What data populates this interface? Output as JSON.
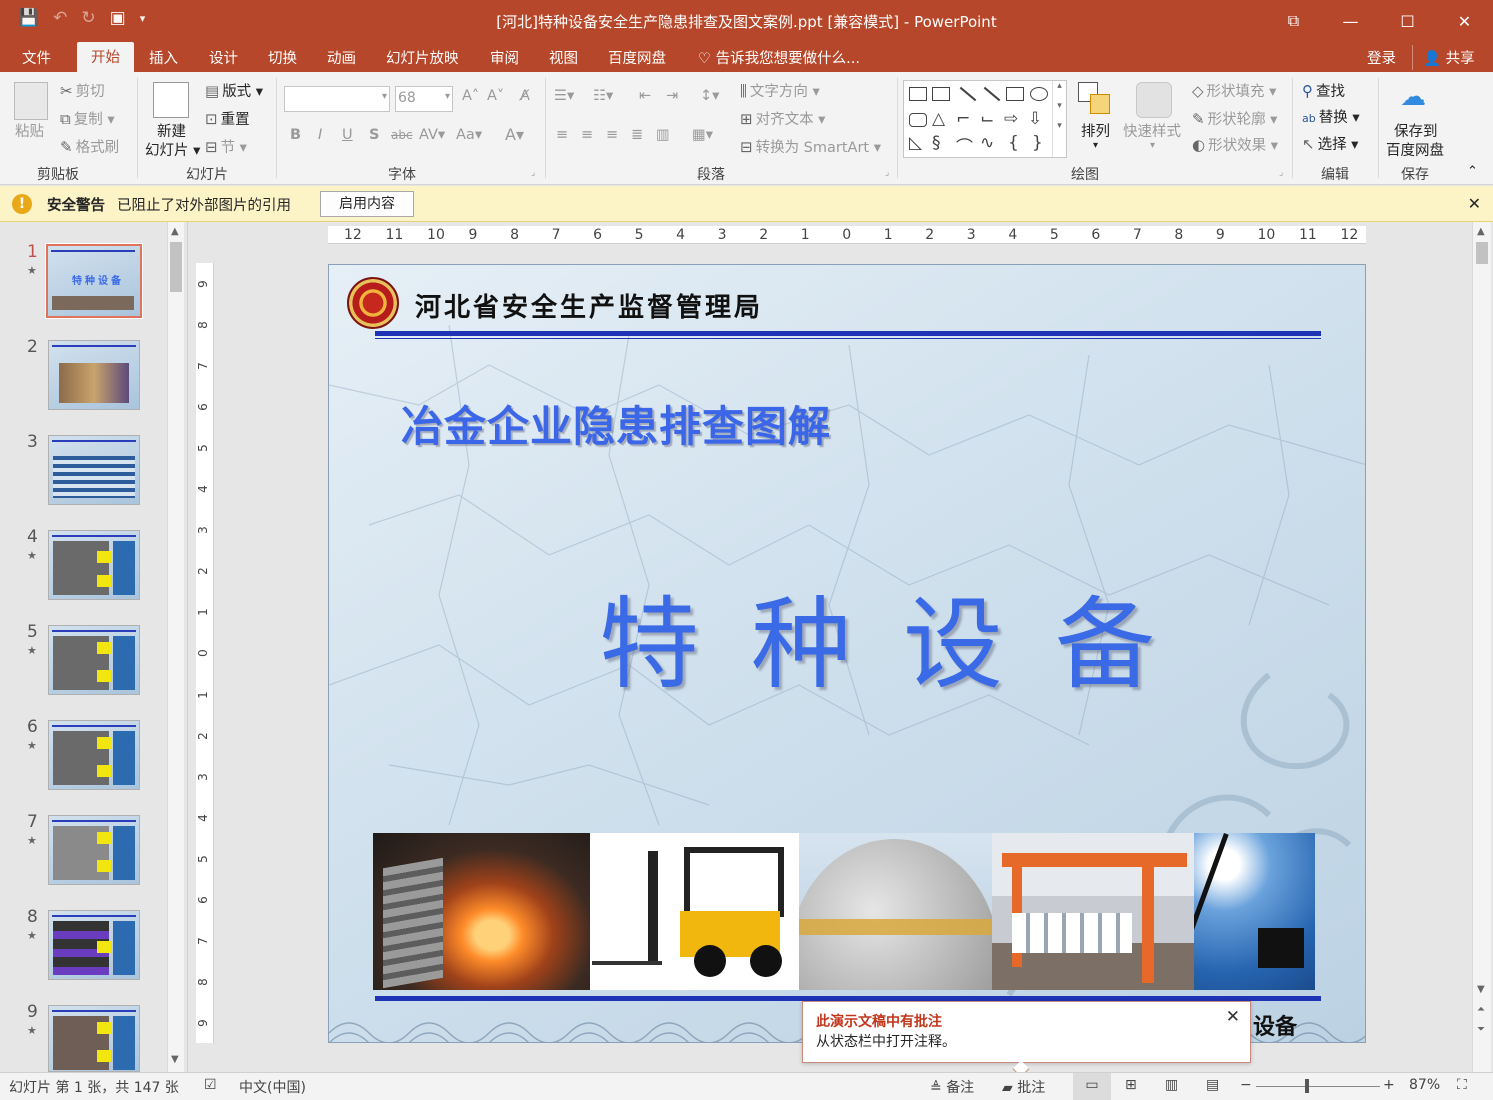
{
  "window": {
    "title": "[河北]特种设备安全生产隐患排查及图文案例.ppt [兼容模式] - PowerPoint",
    "controls": [
      "⧉",
      "—",
      "☐",
      "✕"
    ]
  },
  "tabs": [
    "文件",
    "开始",
    "插入",
    "设计",
    "切换",
    "动画",
    "幻灯片放映",
    "审阅",
    "视图",
    "百度网盘"
  ],
  "tell_me": "告诉我您想要做什么...",
  "login": "登录",
  "share": "共享",
  "ribbon": {
    "clipboard": {
      "paste": "粘贴",
      "cut": "剪切",
      "copy": "复制",
      "format_painter": "格式刷",
      "label": "剪贴板"
    },
    "slides": {
      "new_slide_1": "新建",
      "new_slide_2": "幻灯片",
      "layout": "版式",
      "reset": "重置",
      "section": "节",
      "label": "幻灯片"
    },
    "font": {
      "size": "68",
      "label": "字体",
      "bold": "B",
      "italic": "I",
      "underline": "U",
      "shadow": "S",
      "strike": "abc",
      "spacing": "AV",
      "case": "Aa",
      "color": "A"
    },
    "paragraph": {
      "text_direction": "文字方向",
      "align_text": "对齐文本",
      "smartart": "转换为 SmartArt",
      "label": "段落"
    },
    "drawing": {
      "arrange": "排列",
      "quick_styles": "快速样式",
      "fill": "形状填充",
      "outline": "形状轮廓",
      "effects": "形状效果",
      "label": "绘图"
    },
    "editing": {
      "find": "查找",
      "replace": "替换",
      "select": "选择",
      "label": "编辑"
    },
    "save": {
      "save_to_1": "保存到",
      "save_to_2": "百度网盘",
      "label": "保存"
    }
  },
  "security": {
    "title": "安全警告",
    "message": "已阻止了对外部图片的引用",
    "button": "启用内容"
  },
  "thumbnails": [
    "1",
    "2",
    "3",
    "4",
    "5",
    "6",
    "7",
    "8",
    "9"
  ],
  "ruler": {
    "horizontal": [
      "12",
      "11",
      "10",
      "9",
      "8",
      "7",
      "6",
      "5",
      "4",
      "3",
      "2",
      "1",
      "0",
      "1",
      "2",
      "3",
      "4",
      "5",
      "6",
      "7",
      "8",
      "9",
      "10",
      "11",
      "12"
    ],
    "vertical": [
      "9",
      "8",
      "7",
      "6",
      "5",
      "4",
      "3",
      "2",
      "1",
      "0",
      "1",
      "2",
      "3",
      "4",
      "5",
      "6",
      "7",
      "8",
      "9"
    ]
  },
  "slide": {
    "bureau": "河北省安全生产监督管理局",
    "subtitle": "冶金企业隐患排查图解",
    "title": "特种设备",
    "footer_text": "设备"
  },
  "popup": {
    "title": "此演示文稿中有批注",
    "message": "从状态栏中打开注释。"
  },
  "status": {
    "slide_info": "幻灯片 第 1 张，共 147 张",
    "language": "中文(中国)",
    "notes": "备注",
    "comments": "批注",
    "zoom": "87%"
  }
}
